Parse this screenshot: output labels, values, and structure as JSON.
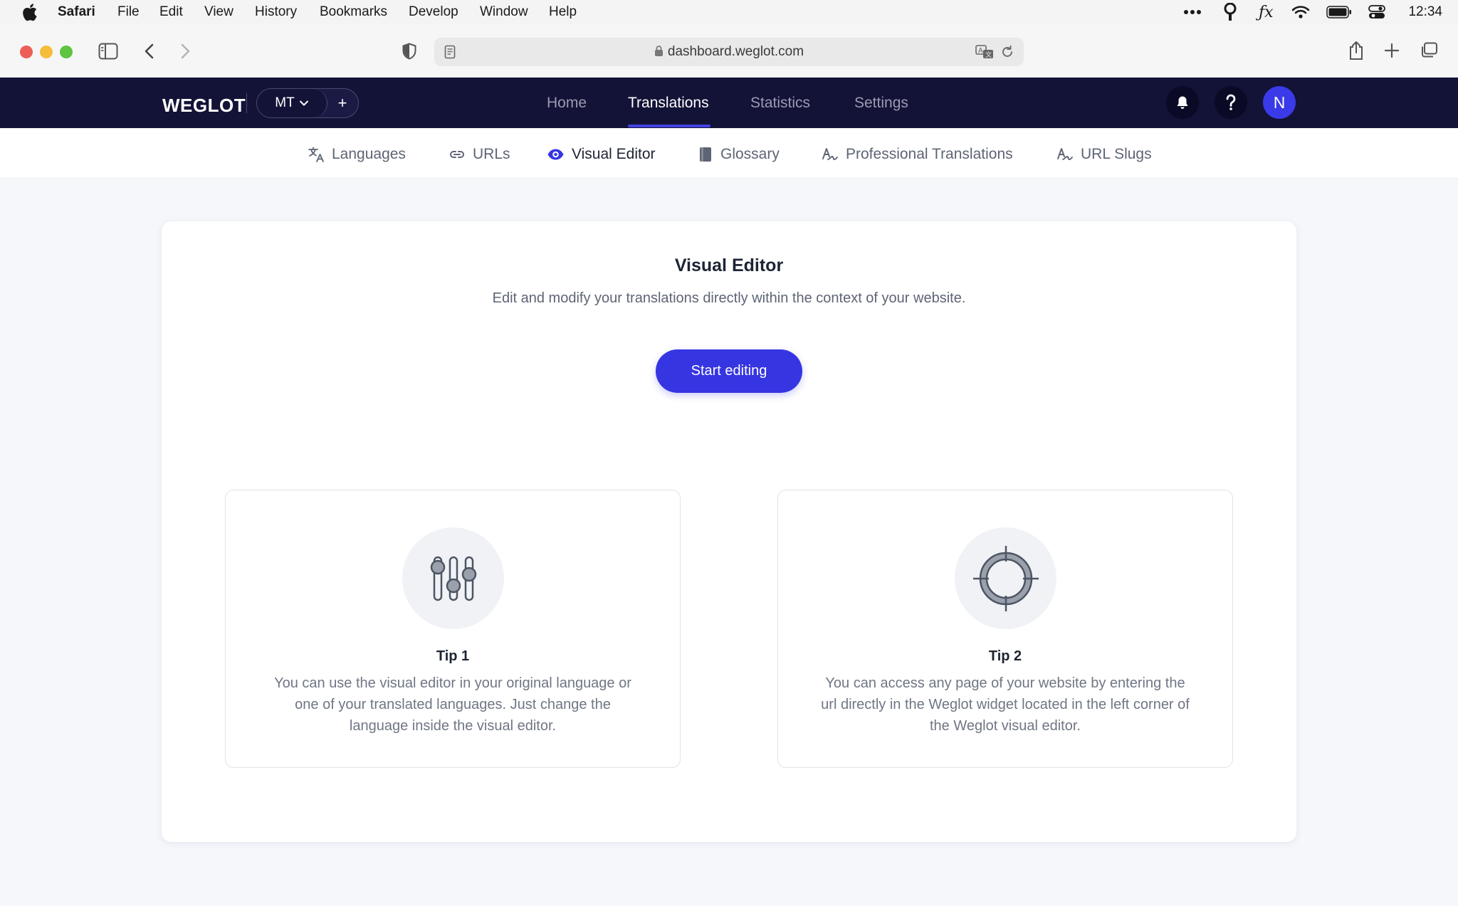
{
  "menubar": {
    "app": "Safari",
    "items": [
      "File",
      "Edit",
      "View",
      "History",
      "Bookmarks",
      "Develop",
      "Window",
      "Help"
    ],
    "clock": "12:34",
    "status_icons": [
      "more-icon",
      "password-icon",
      "fx-icon",
      "wifi-icon",
      "battery-icon",
      "control-center-icon"
    ]
  },
  "browser": {
    "url": "dashboard.weglot.com"
  },
  "header": {
    "logo": "WEGLOT",
    "project": "MT",
    "add_label": "+",
    "nav": [
      "Home",
      "Translations",
      "Statistics",
      "Settings"
    ],
    "active_nav": "Translations",
    "avatar_initial": "N"
  },
  "subnav": {
    "items": [
      "Languages",
      "URLs",
      "Visual Editor",
      "Glossary",
      "Professional Translations",
      "URL Slugs"
    ],
    "active": "Visual Editor"
  },
  "main": {
    "title": "Visual Editor",
    "subtitle": "Edit and modify your translations directly within the context of your website.",
    "cta": "Start editing",
    "tips": [
      {
        "title": "Tip 1",
        "text": "You can use the visual editor in your original language or one of your translated languages. Just change the language inside the visual editor.",
        "icon": "sliders-icon"
      },
      {
        "title": "Tip 2",
        "text": "You can access any page of your website by entering the url directly in the Weglot widget located in the left corner of the Weglot visual editor.",
        "icon": "target-icon"
      }
    ]
  },
  "colors": {
    "header_bg": "#131237",
    "accent": "#3535e2",
    "page_bg": "#f5f7fb"
  }
}
